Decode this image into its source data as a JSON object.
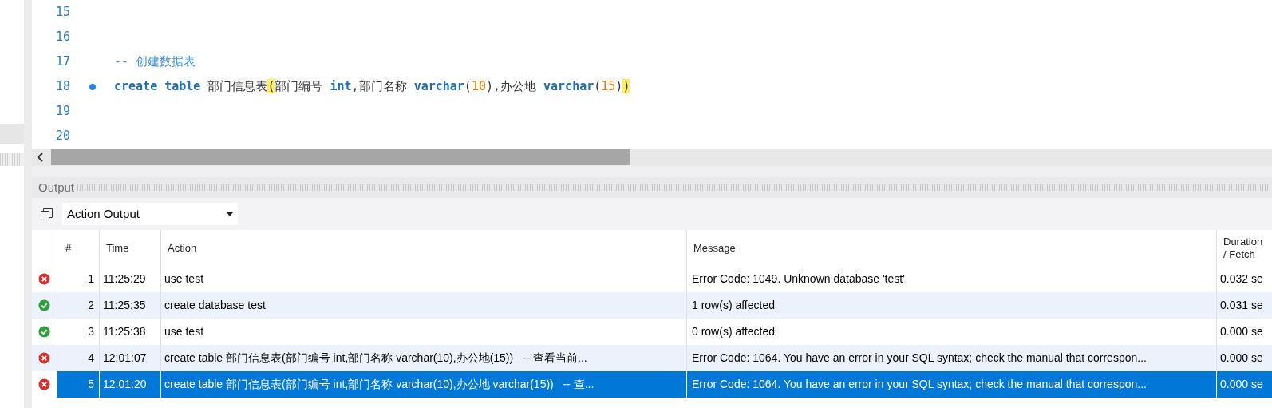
{
  "editor": {
    "lines": [
      {
        "number": "15",
        "marked": false
      },
      {
        "number": "16",
        "marked": false
      },
      {
        "number": "17",
        "marked": false,
        "tokens": [
          {
            "kind": "comment",
            "text": "-- 创建数据表"
          }
        ]
      },
      {
        "number": "18",
        "marked": true,
        "tokens": [
          {
            "kind": "keyword",
            "text": "create"
          },
          {
            "kind": "keyword",
            "text": " table"
          },
          {
            "kind": "text",
            "text": " 部门信息表"
          },
          {
            "kind": "match",
            "text": "("
          },
          {
            "kind": "text",
            "text": "部门编号 "
          },
          {
            "kind": "keyword",
            "text": "int"
          },
          {
            "kind": "text",
            "text": ",部门名称 "
          },
          {
            "kind": "keyword",
            "text": "varchar"
          },
          {
            "kind": "text",
            "text": "("
          },
          {
            "kind": "number",
            "text": "10"
          },
          {
            "kind": "text",
            "text": "),办公地 "
          },
          {
            "kind": "keyword",
            "text": "varchar"
          },
          {
            "kind": "text",
            "text": "("
          },
          {
            "kind": "number",
            "text": "15"
          },
          {
            "kind": "text",
            "text": ")"
          },
          {
            "kind": "match",
            "text": ")"
          }
        ]
      },
      {
        "number": "19",
        "marked": false
      },
      {
        "number": "20",
        "marked": false
      }
    ]
  },
  "output": {
    "title": "Output",
    "selector": {
      "value": "Action Output"
    },
    "table": {
      "columns": [
        "#",
        "Time",
        "Action",
        "Message"
      ],
      "last_column": [
        "Duration",
        "/ Fetch"
      ],
      "rows": [
        {
          "kind": "error",
          "number": "1",
          "time": "11:25:29",
          "action": "use test",
          "message": "Error Code: 1049. Unknown database 'test'",
          "duration": "0.032 se",
          "selected": false
        },
        {
          "kind": "ok",
          "number": "2",
          "time": "11:25:35",
          "action": "create database test",
          "message": "1 row(s) affected",
          "duration": "0.031 se",
          "selected": false
        },
        {
          "kind": "ok",
          "number": "3",
          "time": "11:25:38",
          "action": "use test",
          "message": "0 row(s) affected",
          "duration": "0.000 se",
          "selected": false
        },
        {
          "kind": "error",
          "number": "4",
          "time": "12:01:07",
          "action": "create table 部门信息表(部门编号 int,部门名称 varchar(10),办公地(15))   -- 查看当前...",
          "message": "Error Code: 1064. You have an error in your SQL syntax; check the manual that correspon...",
          "duration": "0.000 se",
          "selected": false
        },
        {
          "kind": "error",
          "number": "5",
          "time": "12:01:20",
          "action": "create table 部门信息表(部门编号 int,部门名称 varchar(10),办公地 varchar(15))   -- 查...",
          "message": "Error Code: 1064. You have an error in your SQL syntax; check the manual that correspon...",
          "duration": "0.000 se",
          "selected": true
        }
      ]
    }
  }
}
